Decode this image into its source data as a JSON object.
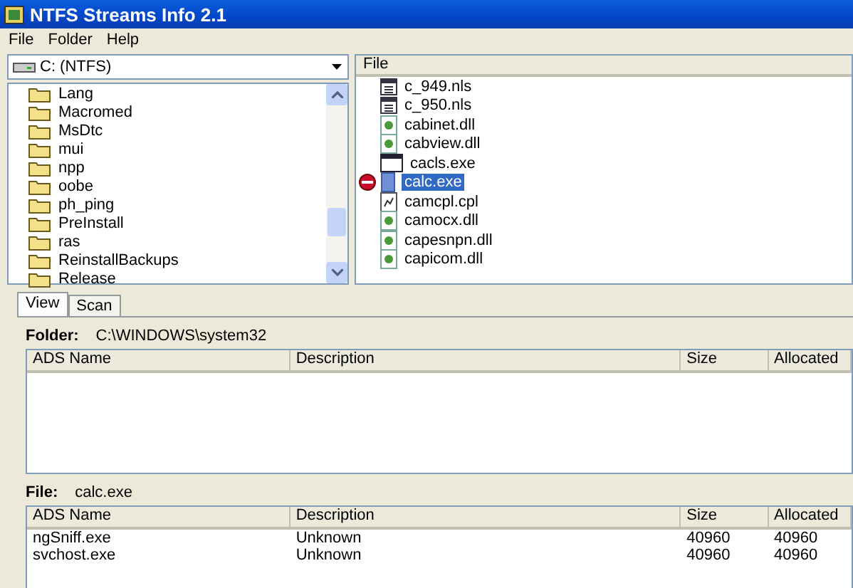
{
  "window": {
    "title": "NTFS Streams Info 2.1"
  },
  "menu": [
    "File",
    "Folder",
    "Help"
  ],
  "drive": {
    "value": "C:  (NTFS)"
  },
  "folders": [
    {
      "name": "Lang"
    },
    {
      "name": "Macromed"
    },
    {
      "name": "MsDtc"
    },
    {
      "name": "mui"
    },
    {
      "name": "npp"
    },
    {
      "name": "oobe"
    },
    {
      "name": "ph_ping"
    },
    {
      "name": "PreInstall"
    },
    {
      "name": "ras"
    },
    {
      "name": "ReinstallBackups"
    },
    {
      "name": "Release"
    }
  ],
  "file_list": {
    "column": "File",
    "items": [
      {
        "name": "c_949.nls",
        "kind": "nls",
        "selected": false,
        "has_streams": false
      },
      {
        "name": "c_950.nls",
        "kind": "nls",
        "selected": false,
        "has_streams": false
      },
      {
        "name": "cabinet.dll",
        "kind": "dll",
        "selected": false,
        "has_streams": false
      },
      {
        "name": "cabview.dll",
        "kind": "dll",
        "selected": false,
        "has_streams": false
      },
      {
        "name": "cacls.exe",
        "kind": "exe",
        "selected": false,
        "has_streams": false
      },
      {
        "name": "calc.exe",
        "kind": "exe",
        "selected": true,
        "has_streams": true
      },
      {
        "name": "camcpl.cpl",
        "kind": "cpl",
        "selected": false,
        "has_streams": false
      },
      {
        "name": "camocx.dll",
        "kind": "dll",
        "selected": false,
        "has_streams": false
      },
      {
        "name": "capesnpn.dll",
        "kind": "dll",
        "selected": false,
        "has_streams": false
      },
      {
        "name": "capicom.dll",
        "kind": "dll",
        "selected": false,
        "has_streams": false
      }
    ]
  },
  "tabs": [
    {
      "label": "View",
      "selected": true
    },
    {
      "label": "Scan",
      "selected": false
    }
  ],
  "folder_info": {
    "label": "Folder:",
    "value": "C:\\WINDOWS\\system32",
    "table": {
      "columns": [
        "ADS Name",
        "Description",
        "Size",
        "Allocated"
      ]
    }
  },
  "file_info": {
    "label": "File:",
    "value": "calc.exe",
    "table": {
      "columns": [
        "ADS Name",
        "Description",
        "Size",
        "Allocated"
      ],
      "rows": [
        [
          "ngSniff.exe",
          "Unknown",
          "40960",
          "40960"
        ],
        [
          "svchost.exe",
          "Unknown",
          "40960",
          "40960"
        ]
      ]
    }
  }
}
